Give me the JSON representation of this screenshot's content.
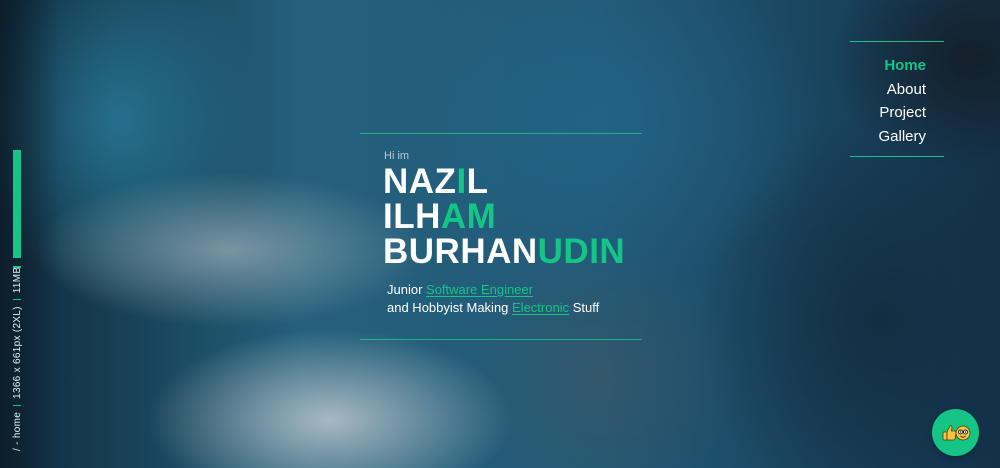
{
  "sidebar": {
    "path": "/ - home",
    "resolution": "1366 x 661px (2XL)",
    "size": "11MB"
  },
  "hero": {
    "greeting": "Hi im",
    "name_line1_a": "NAZ",
    "name_line1_b": "I",
    "name_line1_c": "L",
    "name_line2_a": "ILH",
    "name_line2_b": "AM",
    "name_line3_a": "BURHAN",
    "name_line3_b": "UDIN",
    "tagline1_a": "Junior ",
    "tagline1_link": "Software Engineer",
    "tagline2_a": "and Hobbyist Making ",
    "tagline2_link": "Electronic",
    "tagline2_b": " Stuff"
  },
  "nav": {
    "items": [
      {
        "label": "Home"
      },
      {
        "label": "About"
      },
      {
        "label": "Project"
      },
      {
        "label": "Gallery"
      }
    ]
  },
  "fab": {
    "icon": "thumbs-up-emoji-icon"
  },
  "colors": {
    "accent": "#14c586",
    "text": "#ffffff"
  }
}
